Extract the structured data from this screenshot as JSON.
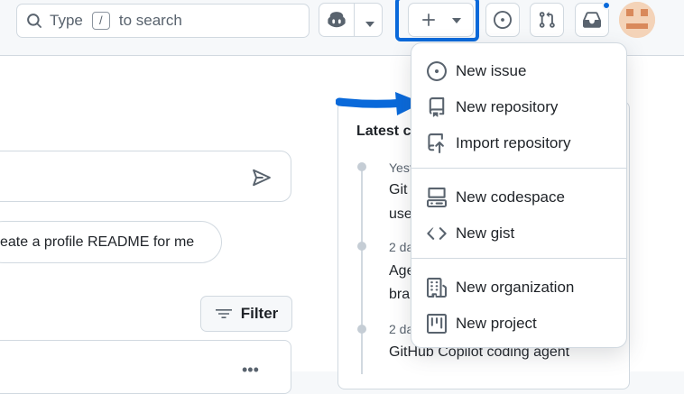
{
  "search": {
    "prefix": "Type",
    "key": "/",
    "suffix": "to search"
  },
  "create_menu": {
    "items": [
      {
        "label": "New issue",
        "icon": "issue-opened-icon"
      },
      {
        "label": "New repository",
        "icon": "repo-icon"
      },
      {
        "label": "Import repository",
        "icon": "repo-push-icon"
      },
      {
        "label": "New codespace",
        "icon": "codespaces-icon"
      },
      {
        "label": "New gist",
        "icon": "code-icon"
      },
      {
        "label": "New organization",
        "icon": "organization-icon"
      },
      {
        "label": "New project",
        "icon": "project-icon"
      }
    ]
  },
  "chat": {
    "suggestion": "eate a profile README for me"
  },
  "filter": {
    "label": "Filter"
  },
  "latest_changes": {
    "title": "Latest c",
    "entries": [
      {
        "date": "Yest",
        "line1": "Git",
        "line2": "use"
      },
      {
        "date": "2 da",
        "line1": "Age",
        "line2": "bra"
      },
      {
        "date": "2 da",
        "line1": "GitHub Copilot coding agent",
        "line2": ""
      }
    ]
  },
  "colors": {
    "accent": "#0969da",
    "border": "#d1d9e0",
    "text": "#1f2328",
    "muted": "#59636e"
  }
}
